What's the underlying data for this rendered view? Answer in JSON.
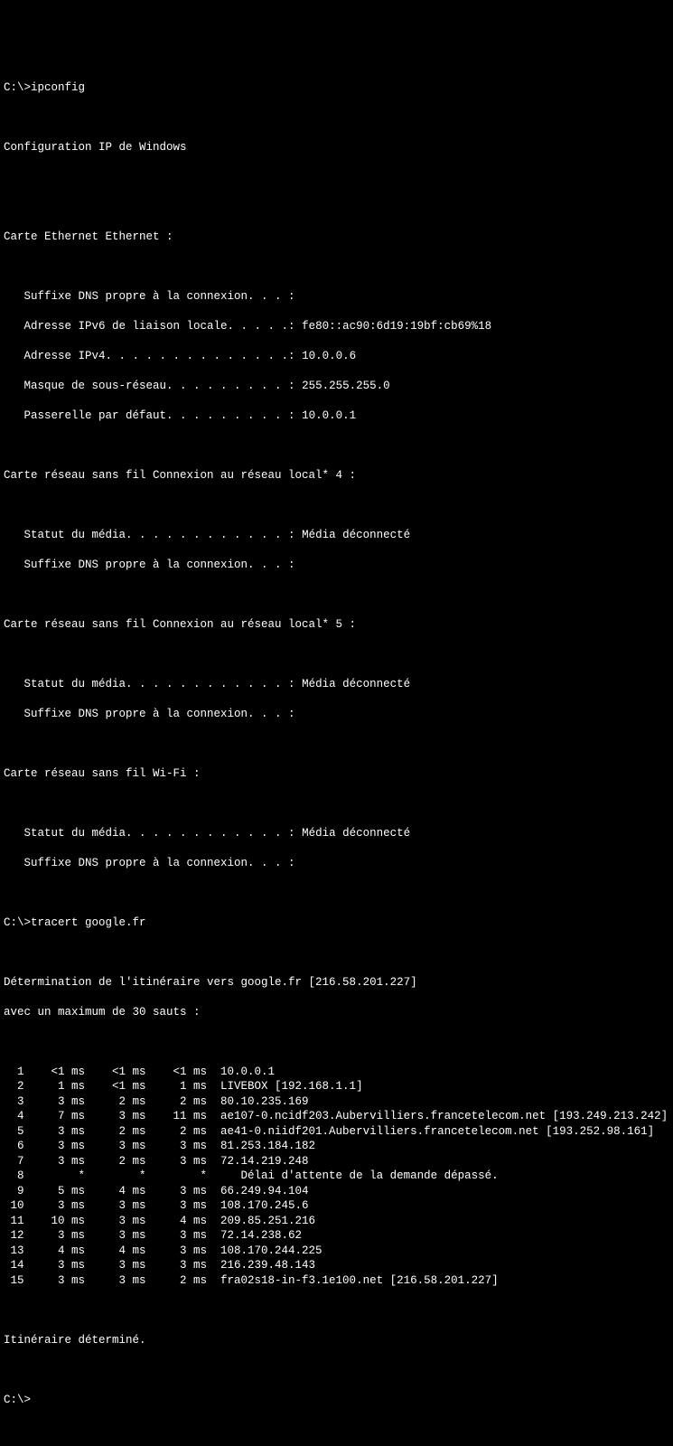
{
  "prompt1": "C:\\>",
  "cmd1": "ipconfig",
  "title": "Configuration IP de Windows",
  "ethernet": {
    "header": "Carte Ethernet Ethernet :",
    "dns_suffix_label": "   Suffixe DNS propre à la connexion. . . :",
    "ipv6_label": "   Adresse IPv6 de liaison locale. . . . .:",
    "ipv6": " fe80::ac90:6d19:19bf:cb69%18",
    "ipv4_label": "   Adresse IPv4. . . . . . . . . . . . . .:",
    "ipv4": " 10.0.0.6",
    "mask_label": "   Masque de sous-réseau. . . . . . . . . :",
    "mask": " 255.255.255.0",
    "gw_label": "   Passerelle par défaut. . . . . . . . . :",
    "gw": " 10.0.0.1"
  },
  "wlan4": {
    "header": "Carte réseau sans fil Connexion au réseau local* 4 :",
    "status_label": "   Statut du média. . . . . . . . . . . . :",
    "status": " Média déconnecté",
    "dns_suffix_label": "   Suffixe DNS propre à la connexion. . . :"
  },
  "wlan5": {
    "header": "Carte réseau sans fil Connexion au réseau local* 5 :",
    "status_label": "   Statut du média. . . . . . . . . . . . :",
    "status": " Média déconnecté",
    "dns_suffix_label": "   Suffixe DNS propre à la connexion. . . :"
  },
  "wifi": {
    "header": "Carte réseau sans fil Wi-Fi :",
    "status_label": "   Statut du média. . . . . . . . . . . . :",
    "status": " Média déconnecté",
    "dns_suffix_label": "   Suffixe DNS propre à la connexion. . . :"
  },
  "prompt2": "C:\\>",
  "cmd2": "tracert google.fr",
  "trace_header1": "Détermination de l'itinéraire vers google.fr [216.58.201.227]",
  "trace_header2": "avec un maximum de 30 sauts :",
  "hops": [
    {
      "n": 1,
      "t1": "<1 ms",
      "t2": "<1 ms",
      "t3": "<1 ms",
      "host": "10.0.0.1"
    },
    {
      "n": 2,
      "t1": "1 ms",
      "t2": "<1 ms",
      "t3": "1 ms",
      "host": "LIVEBOX [192.168.1.1]"
    },
    {
      "n": 3,
      "t1": "3 ms",
      "t2": "2 ms",
      "t3": "2 ms",
      "host": "80.10.235.169"
    },
    {
      "n": 4,
      "t1": "7 ms",
      "t2": "3 ms",
      "t3": "11 ms",
      "host": "ae107-0.ncidf203.Aubervilliers.francetelecom.net [193.249.213.242]"
    },
    {
      "n": 5,
      "t1": "3 ms",
      "t2": "2 ms",
      "t3": "2 ms",
      "host": "ae41-0.niidf201.Aubervilliers.francetelecom.net [193.252.98.161]"
    },
    {
      "n": 6,
      "t1": "3 ms",
      "t2": "3 ms",
      "t3": "3 ms",
      "host": "81.253.184.182"
    },
    {
      "n": 7,
      "t1": "3 ms",
      "t2": "2 ms",
      "t3": "3 ms",
      "host": "72.14.219.248"
    },
    {
      "n": 8,
      "t1": "*",
      "t2": "*",
      "t3": "*",
      "host": "Délai d'attente de la demande dépassé."
    },
    {
      "n": 9,
      "t1": "5 ms",
      "t2": "4 ms",
      "t3": "3 ms",
      "host": "66.249.94.104"
    },
    {
      "n": 10,
      "t1": "3 ms",
      "t2": "3 ms",
      "t3": "3 ms",
      "host": "108.170.245.6"
    },
    {
      "n": 11,
      "t1": "10 ms",
      "t2": "3 ms",
      "t3": "4 ms",
      "host": "209.85.251.216"
    },
    {
      "n": 12,
      "t1": "3 ms",
      "t2": "3 ms",
      "t3": "3 ms",
      "host": "72.14.238.62"
    },
    {
      "n": 13,
      "t1": "4 ms",
      "t2": "4 ms",
      "t3": "3 ms",
      "host": "108.170.244.225"
    },
    {
      "n": 14,
      "t1": "3 ms",
      "t2": "3 ms",
      "t3": "3 ms",
      "host": "216.239.48.143"
    },
    {
      "n": 15,
      "t1": "3 ms",
      "t2": "3 ms",
      "t3": "2 ms",
      "host": "fra02s18-in-f3.1e100.net [216.58.201.227]"
    }
  ],
  "trace_done": "Itinéraire déterminé.",
  "prompt3": "C:\\>"
}
